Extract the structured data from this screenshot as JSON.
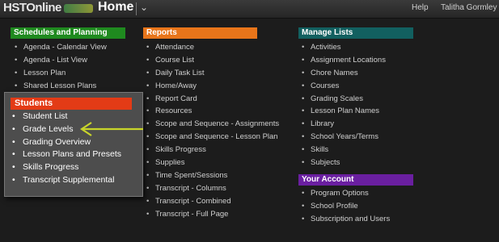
{
  "topbar": {
    "logo_text": "HSTOnline",
    "page_title": "Home",
    "menu_chevron": "⌄",
    "help_label": "Help",
    "user_name": "Talitha Gormley"
  },
  "colors": {
    "schedules": "#1f8a1f",
    "reports": "#e8751a",
    "manage_lists": "#126060",
    "your_account": "#6a1fa0",
    "students": "#e33b16",
    "arrow": "#c8d42a"
  },
  "schedules": {
    "heading": "Schedules and Planning",
    "items": [
      "Agenda - Calendar View",
      "Agenda - List View",
      "Lesson Plan",
      "Shared Lesson Plans"
    ]
  },
  "reports": {
    "heading": "Reports",
    "items": [
      "Attendance",
      "Course List",
      "Daily Task List",
      "Home/Away",
      "Report Card",
      "Resources",
      "Scope and Sequence - Assignments",
      "Scope and Sequence - Lesson Plan",
      "Skills Progress",
      "Supplies",
      "Time Spent/Sessions",
      "Transcript - Columns",
      "Transcript - Combined",
      "Transcript - Full Page"
    ]
  },
  "manage_lists": {
    "heading": "Manage Lists",
    "items": [
      "Activities",
      "Assignment Locations",
      "Chore Names",
      "Courses",
      "Grading Scales",
      "Lesson Plan Names",
      "Library",
      "School Years/Terms",
      "Skills",
      "Subjects"
    ]
  },
  "your_account": {
    "heading": "Your Account",
    "items": [
      "Program Options",
      "School Profile",
      "Subscription and Users"
    ]
  },
  "students": {
    "heading": "Students",
    "items": [
      "Student List",
      "Grade Levels",
      "Grading Overview",
      "Lesson Plans and Presets",
      "Skills Progress",
      "Transcript Supplemental"
    ]
  }
}
